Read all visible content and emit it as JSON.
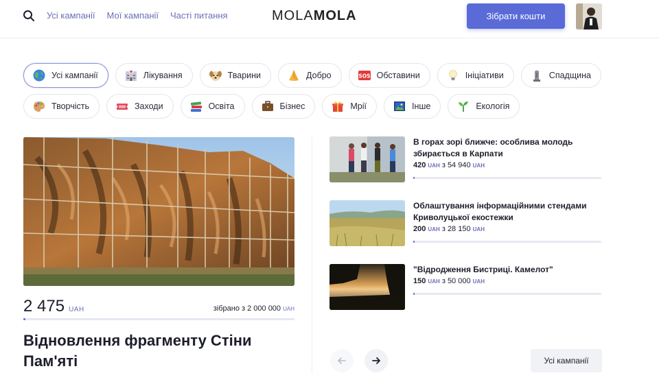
{
  "header": {
    "nav": [
      "Усі кампанії",
      "Мої кампанії",
      "Часті питання"
    ],
    "logo_light": "MOLA",
    "logo_bold": "MOLA",
    "cta_label": "Зібрати кошти"
  },
  "categories": {
    "row1": [
      {
        "label": "Усі кампанії",
        "icon": "globe-icon",
        "active": true
      },
      {
        "label": "Лікування",
        "icon": "hospital-icon"
      },
      {
        "label": "Тварини",
        "icon": "dog-icon"
      },
      {
        "label": "Добро",
        "icon": "praying-hands-icon"
      },
      {
        "label": "Обставини",
        "icon": "sos-icon"
      },
      {
        "label": "Ініціативи",
        "icon": "lightbulb-icon"
      },
      {
        "label": "Спадщина",
        "icon": "monument-icon"
      }
    ],
    "row2": [
      {
        "label": "Творчість",
        "icon": "palette-icon"
      },
      {
        "label": "Заходи",
        "icon": "ticket-icon"
      },
      {
        "label": "Освіта",
        "icon": "books-icon"
      },
      {
        "label": "Бізнес",
        "icon": "briefcase-icon"
      },
      {
        "label": "Мрії",
        "icon": "gift-icon"
      },
      {
        "label": "Інше",
        "icon": "picture-icon"
      },
      {
        "label": "Екологія",
        "icon": "sprout-icon"
      }
    ]
  },
  "featured": {
    "amount": "2 475",
    "currency": "UAH",
    "goal_prefix": "зібрано з",
    "goal": "2 000 000",
    "progress": 0.0012,
    "title": "Відновлення фрагменту Стіни Пам'яті"
  },
  "campaigns": [
    {
      "title": "В горах зорі ближче: особлива молодь збирається в Карпати",
      "raised": "420",
      "goal": "54 940",
      "progress": 0.0076
    },
    {
      "title": "Облаштування інформаційними стендами Криволуцької екостежки",
      "raised": "200",
      "goal": "28 150",
      "progress": 0.0071
    },
    {
      "title": "\"Відродження Бистриці. Камелот\"",
      "raised": "150",
      "goal": "50 000",
      "progress": 0.003
    }
  ],
  "labels": {
    "currency": "UAH",
    "of": "з",
    "all_campaigns": "Усі кампанії"
  },
  "colors": {
    "accent": "#5a6bd8",
    "nav": "#6b6fb5"
  }
}
